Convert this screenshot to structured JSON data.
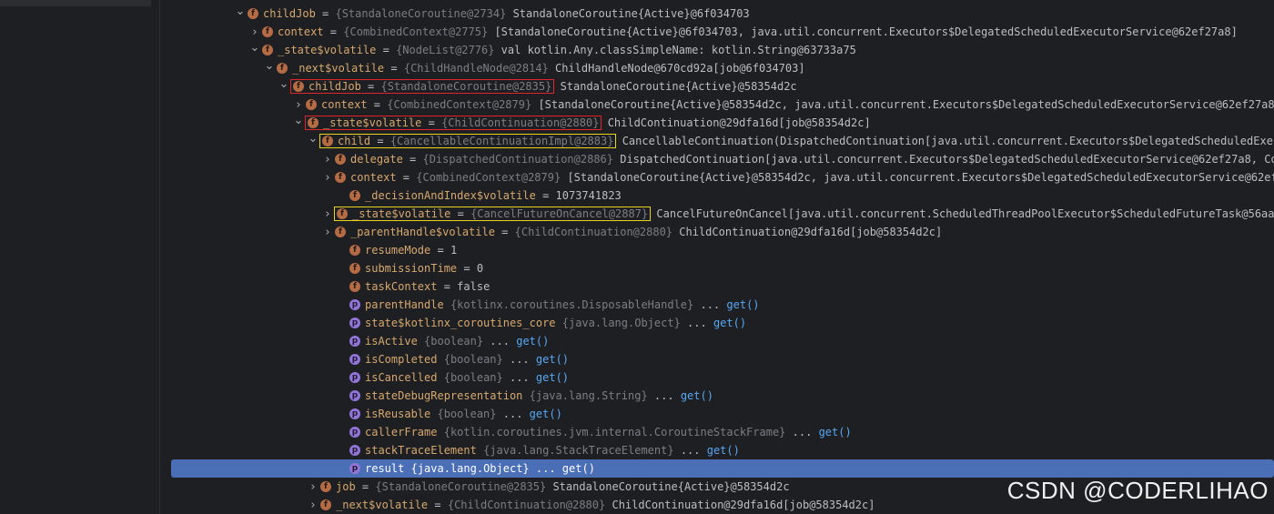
{
  "rows": [
    {
      "name": "childJob",
      "type": "{StandaloneCoroutine@2734}",
      "value": "StandaloneCoroutine{Active}@6f034703",
      "arrow": "down",
      "icon": "field"
    },
    {
      "name": "context",
      "type": "{CombinedContext@2775}",
      "value": "[StandaloneCoroutine{Active}@6f034703, java.util.concurrent.Executors$DelegatedScheduledExecutorService@62ef27a8]",
      "arrow": "right",
      "icon": "field"
    },
    {
      "name": "_state$volatile",
      "type": "{NodeList@2776}",
      "value": "val kotlin.Any.classSimpleName: kotlin.String@63733a75",
      "arrow": "down",
      "icon": "field"
    },
    {
      "name": "_next$volatile",
      "type": "{ChildHandleNode@2814}",
      "value": "ChildHandleNode@670cd92a[job@6f034703]",
      "arrow": "down",
      "icon": "field"
    },
    {
      "name": "childJob",
      "type": "{StandaloneCoroutine@2835}",
      "value": "StandaloneCoroutine{Active}@58354d2c",
      "arrow": "down",
      "icon": "field"
    },
    {
      "name": "context",
      "type": "{CombinedContext@2879}",
      "value": "[StandaloneCoroutine{Active}@58354d2c, java.util.concurrent.Executors$DelegatedScheduledExecutorService@62ef27a8]",
      "arrow": "right",
      "icon": "field"
    },
    {
      "name": "_state$volatile",
      "type": "{ChildContinuation@2880}",
      "value": "ChildContinuation@29dfa16d[job@58354d2c]",
      "arrow": "down",
      "icon": "field"
    },
    {
      "name": "child",
      "type": "{CancellableContinuationImpl@2883}",
      "value": "CancellableContinuation(DispatchedContinuation[java.util.concurrent.Executors$DelegatedScheduledExecuto",
      "arrow": "down",
      "icon": "field"
    },
    {
      "name": "delegate",
      "type": "{DispatchedContinuation@2886}",
      "value": "DispatchedContinuation[java.util.concurrent.Executors$DelegatedScheduledExecutorService@62ef27a8, Cont",
      "arrow": "right",
      "icon": "field"
    },
    {
      "name": "context",
      "type": "{CombinedContext@2879}",
      "value": "[StandaloneCoroutine{Active}@58354d2c, java.util.concurrent.Executors$DelegatedScheduledExecutorService@62ef27",
      "arrow": "right",
      "icon": "field"
    },
    {
      "name": "_decisionAndIndex$volatile",
      "type": "",
      "value": "1073741823",
      "arrow": "",
      "icon": "field"
    },
    {
      "name": "_state$volatile",
      "type": "{CancelFutureOnCancel@2887}",
      "value": "CancelFutureOnCancel[java.util.concurrent.ScheduledThreadPoolExecutor$ScheduledFutureTask@56aa176",
      "arrow": "right",
      "icon": "field"
    },
    {
      "name": "_parentHandle$volatile",
      "type": "{ChildContinuation@2880}",
      "value": "ChildContinuation@29dfa16d[job@58354d2c]",
      "arrow": "right",
      "icon": "field"
    },
    {
      "name": "resumeMode",
      "type": "",
      "value": "1",
      "arrow": "",
      "icon": "field"
    },
    {
      "name": "submissionTime",
      "type": "",
      "value": "0",
      "arrow": "",
      "icon": "field"
    },
    {
      "name": "taskContext",
      "type": "",
      "value": "false",
      "arrow": "",
      "icon": "field"
    },
    {
      "name": "parentHandle",
      "type": "{kotlinx.coroutines.DisposableHandle}",
      "value": "...",
      "get": "get()",
      "arrow": "",
      "icon": "prop"
    },
    {
      "name": "state$kotlinx_coroutines_core",
      "type": "{java.lang.Object}",
      "value": "...",
      "get": "get()",
      "arrow": "",
      "icon": "prop"
    },
    {
      "name": "isActive",
      "type": "{boolean}",
      "value": "...",
      "get": "get()",
      "arrow": "",
      "icon": "prop"
    },
    {
      "name": "isCompleted",
      "type": "{boolean}",
      "value": "...",
      "get": "get()",
      "arrow": "",
      "icon": "prop"
    },
    {
      "name": "isCancelled",
      "type": "{boolean}",
      "value": "...",
      "get": "get()",
      "arrow": "",
      "icon": "prop"
    },
    {
      "name": "stateDebugRepresentation",
      "type": "{java.lang.String}",
      "value": "...",
      "get": "get()",
      "arrow": "",
      "icon": "prop"
    },
    {
      "name": "isReusable",
      "type": "{boolean}",
      "value": "...",
      "get": "get()",
      "arrow": "",
      "icon": "prop"
    },
    {
      "name": "callerFrame",
      "type": "{kotlin.coroutines.jvm.internal.CoroutineStackFrame}",
      "value": "...",
      "get": "get()",
      "arrow": "",
      "icon": "prop"
    },
    {
      "name": "stackTraceElement",
      "type": "{java.lang.StackTraceElement}",
      "value": "...",
      "get": "get()",
      "arrow": "",
      "icon": "prop"
    },
    {
      "name": "result",
      "type": "{java.lang.Object}",
      "value": "...",
      "get": "get()",
      "arrow": "",
      "icon": "prop",
      "selected": true
    },
    {
      "name": "job",
      "type": "{StandaloneCoroutine@2835}",
      "value": "StandaloneCoroutine{Active}@58354d2c",
      "arrow": "right",
      "icon": "field"
    },
    {
      "name": "_next$volatile",
      "type": "{ChildContinuation@2880}",
      "value": "ChildContinuation@29dfa16d[job@58354d2c]",
      "arrow": "right",
      "icon": "field"
    }
  ],
  "icons": {
    "field": "f",
    "prop": "p",
    "arrow_down": "⌄",
    "arrow_right": "›"
  },
  "colors": {
    "background": "#1e1f22",
    "selection": "#4a6fb6",
    "highlight_red": "#e0262b",
    "highlight_yellow": "#e6d41e",
    "field_icon": "#b36c44",
    "property_icon": "#9176d6",
    "name": "#d7a86e",
    "type": "#7a7e85",
    "getter_link": "#56a8f5"
  },
  "watermark": "CSDN @CODERLIHAO"
}
